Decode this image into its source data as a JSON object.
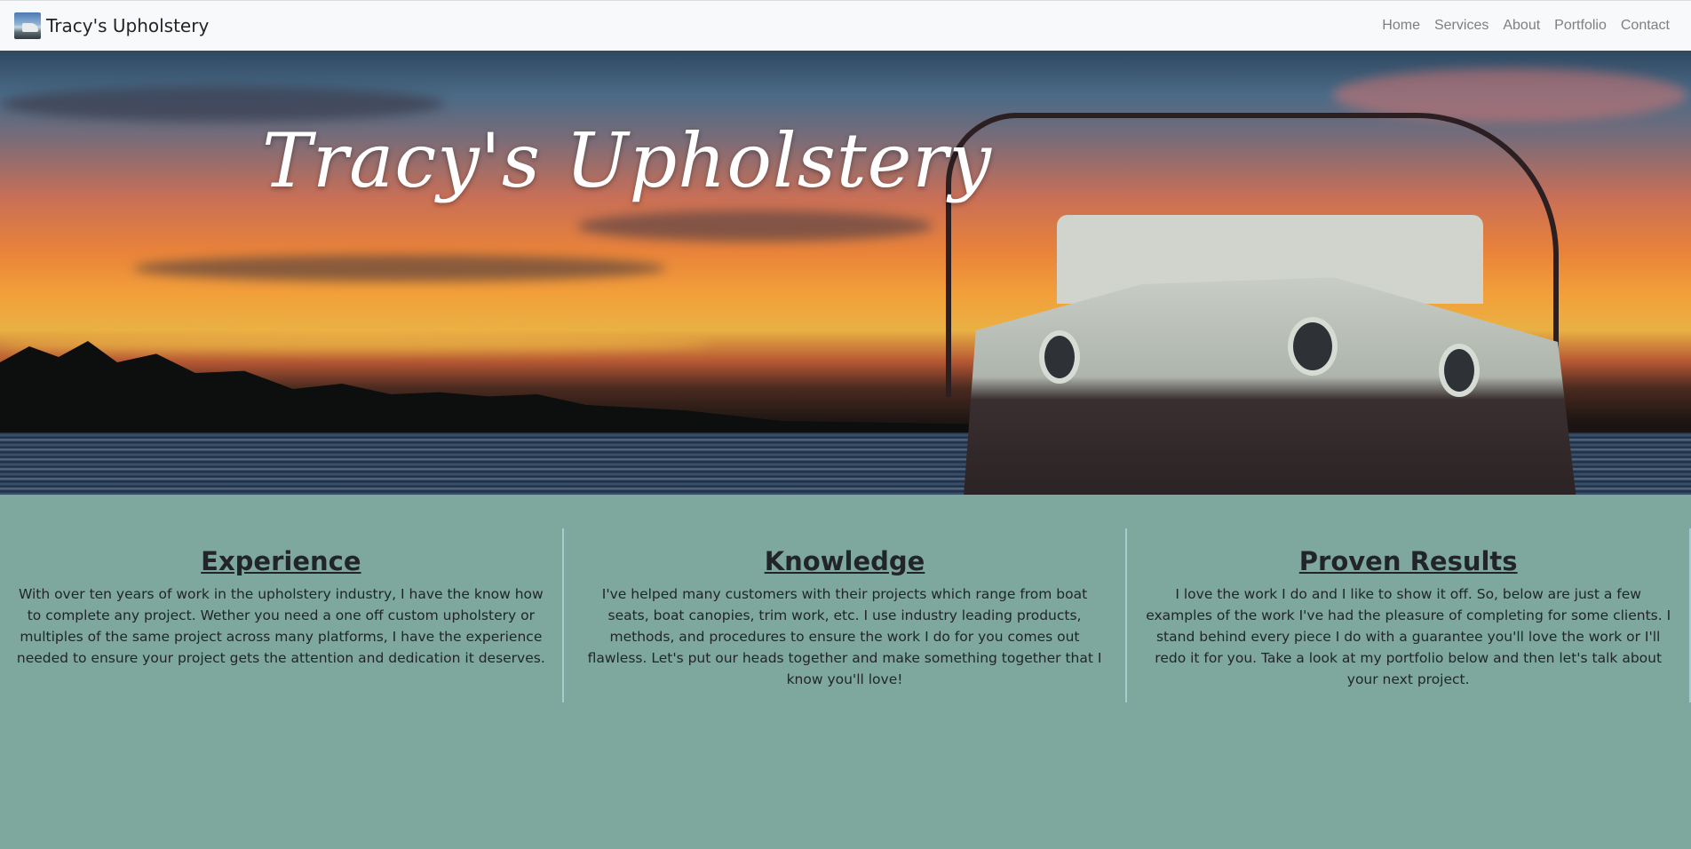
{
  "brand": {
    "name": "Tracy's Upholstery"
  },
  "nav": {
    "links": [
      "Home",
      "Services",
      "About",
      "Portfolio",
      "Contact"
    ]
  },
  "hero": {
    "title": "Tracy's Upholstery",
    "image": "sunset-boat-photo"
  },
  "features": [
    {
      "heading": "Experience",
      "text": "With over ten years of work in the upholstery industry, I have the know how to complete any project. Wether you need a one off custom upholstery or multiples of the same project across many platforms, I have the experience needed to ensure your project gets the attention and dedication it deserves."
    },
    {
      "heading": "Knowledge",
      "text": "I've helped many customers with their projects which range from boat seats, boat canopies, trim work, etc. I use industry leading products, methods, and procedures to ensure the work I do for you comes out flawless. Let's put our heads together and make something together that I know you'll love!"
    },
    {
      "heading": "Proven Results",
      "text": "I love the work I do and I like to show it off. So, below are just a few examples of the work I've had the pleasure of completing for some clients. I stand behind every piece I do with a guarantee you'll love the work or I'll redo it for you. Take a look at my portfolio below and then let's talk about your next project."
    }
  ],
  "colors": {
    "navbar_bg": "#f8f9fa",
    "page_bg": "#7ea89d",
    "divider": "#a6cbd1",
    "nav_link": "#7d7f82"
  }
}
